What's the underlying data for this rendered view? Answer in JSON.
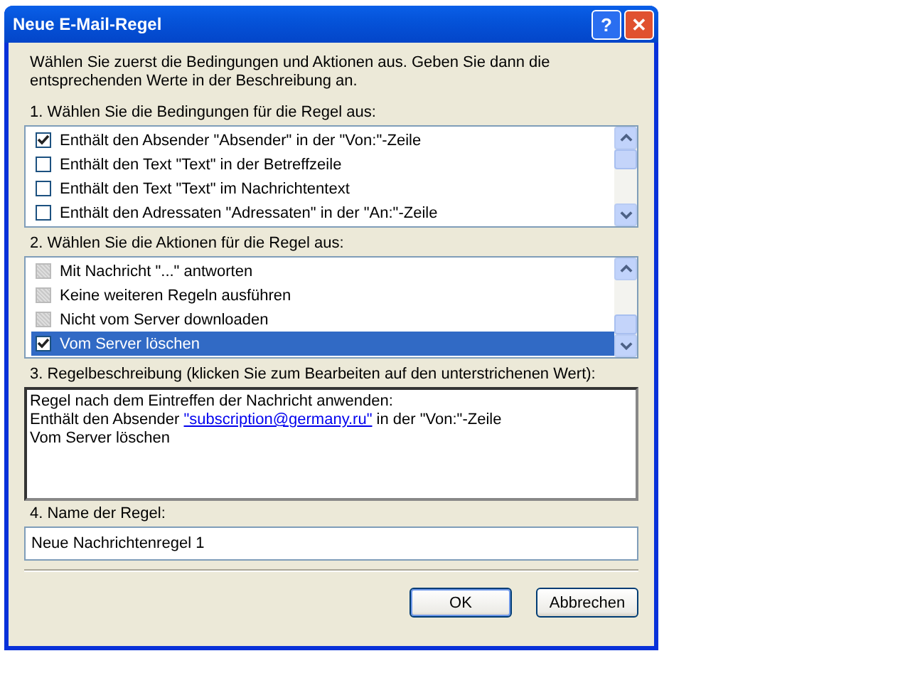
{
  "window": {
    "title": "Neue E-Mail-Regel",
    "buttons": [
      {
        "kind": "help",
        "label": "?"
      },
      {
        "kind": "close",
        "label": "✕"
      }
    ]
  },
  "intro": "Wählen Sie zuerst die Bedingungen und Aktionen aus. Geben Sie dann die entsprechenden Werte in der Beschreibung an.",
  "conditions": {
    "label": "1. Wählen Sie die Bedingungen für die Regel aus:",
    "items": [
      {
        "label": "Enthält den Absender \"Absender\" in der \"Von:\"-Zeile",
        "checked": true,
        "disabled": false,
        "selected": false
      },
      {
        "label": "Enthält den Text \"Text\" in der Betreffzeile",
        "checked": false,
        "disabled": false,
        "selected": false
      },
      {
        "label": "Enthält den Text \"Text\" im Nachrichtentext",
        "checked": false,
        "disabled": false,
        "selected": false
      },
      {
        "label": "Enthält den Adressaten \"Adressaten\" in der \"An:\"-Zeile",
        "checked": false,
        "disabled": false,
        "selected": false
      }
    ]
  },
  "actions": {
    "label": "2. Wählen Sie die Aktionen für die Regel aus:",
    "items": [
      {
        "label": "Mit Nachricht \"...\" antworten",
        "checked": false,
        "disabled": true,
        "selected": false
      },
      {
        "label": "Keine weiteren Regeln ausführen",
        "checked": false,
        "disabled": true,
        "selected": false
      },
      {
        "label": "Nicht vom Server downloaden",
        "checked": false,
        "disabled": true,
        "selected": false
      },
      {
        "label": "Vom Server löschen",
        "checked": true,
        "disabled": false,
        "selected": true
      }
    ]
  },
  "description": {
    "label": "3. Regelbeschreibung (klicken Sie zum Bearbeiten auf den unterstrichenen Wert):",
    "lines": [
      [
        {
          "kind": "text",
          "text": "Regel nach dem Eintreffen der Nachricht anwenden:"
        }
      ],
      [
        {
          "kind": "text",
          "text": "Enthält den Absender "
        },
        {
          "kind": "link",
          "text": "\"subscription@germany.ru\""
        },
        {
          "kind": "text",
          "text": " in der \"Von:\"-Zeile"
        }
      ],
      [
        {
          "kind": "text",
          "text": "Vom Server löschen"
        }
      ]
    ]
  },
  "name": {
    "label": "4. Name der Regel:",
    "value": "Neue Nachrichtenregel 1"
  },
  "buttons": [
    {
      "label": "OK",
      "default": true
    },
    {
      "label": "Abbrechen",
      "default": false
    }
  ]
}
